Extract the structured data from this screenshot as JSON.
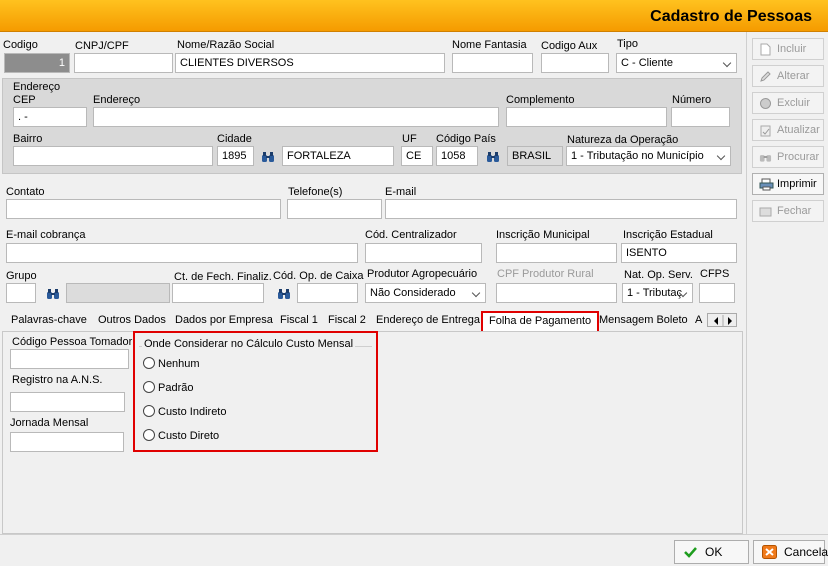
{
  "window": {
    "title": "Cadastro de Pessoas"
  },
  "header": {
    "codigo_label": "Codigo",
    "codigo_value": "1",
    "cnpj_label": "CNPJ/CPF",
    "cnpj_value": "",
    "nome_label": "Nome/Razão Social",
    "nome_value": "CLIENTES DIVERSOS",
    "fantasia_label": "Nome Fantasia",
    "fantasia_value": "",
    "codaux_label": "Codigo Aux",
    "codaux_value": "",
    "tipo_label": "Tipo",
    "tipo_value": "C - Cliente"
  },
  "endereco": {
    "section_label": "Endereço",
    "cep_label": "CEP",
    "cep_value": "  .   -",
    "endereco_label": "Endereço",
    "endereco_value": "",
    "complemento_label": "Complemento",
    "complemento_value": "",
    "numero_label": "Número",
    "numero_value": "",
    "bairro_label": "Bairro",
    "bairro_value": "",
    "cidade_label": "Cidade",
    "cidade_code": "1895",
    "cidade_name": "FORTALEZA",
    "uf_label": "UF",
    "uf_value": "CE",
    "pais_label": "Código País",
    "pais_code": "1058",
    "pais_name": "BRASIL",
    "natureza_label": "Natureza da Operação",
    "natureza_value": "1 - Tributação no Município"
  },
  "contato": {
    "contato_label": "Contato",
    "contato_value": "",
    "telefone_label": "Telefone(s)",
    "telefone_value": "",
    "email_label": "E-mail",
    "email_value": "",
    "email_cobranca_label": "E-mail cobrança",
    "email_cobranca_value": "",
    "centralizador_label": "Cód. Centralizador",
    "centralizador_value": "",
    "insc_mun_label": "Inscrição Municipal",
    "insc_mun_value": "",
    "insc_est_label": "Inscrição Estadual",
    "insc_est_value": "ISENTO"
  },
  "grupo": {
    "grupo_label": "Grupo",
    "grupo_value": "",
    "fech_label": "Ct. de Fech. Finaliz.",
    "fech_value": "",
    "caixa_label": "Cód. Op. de Caixa",
    "caixa_value": "",
    "produtor_label": "Produtor Agropecuário",
    "produtor_value": "Não Considerado",
    "cpf_produtor_label": "CPF Produtor Rural",
    "cpf_produtor_value": "",
    "natop_serv_label": "Nat. Op. Serv.",
    "natop_serv_value": "1 - Tributaç",
    "cfps_label": "CFPS",
    "cfps_value": ""
  },
  "tabs": [
    "Palavras-chave",
    "Outros Dados",
    "Dados por Empresa",
    "Fiscal 1",
    "Fiscal 2",
    "Endereço de Entrega",
    "Folha de Pagamento",
    "Mensagem Boleto",
    "A"
  ],
  "folha": {
    "tomador_label": "Código Pessoa Tomador",
    "tomador_value": "",
    "ans_label": "Registro na A.N.S.",
    "ans_value": "",
    "jornada_label": "Jornada Mensal",
    "jornada_value": "",
    "group_title": "Onde Considerar no Cálculo Custo Mensal",
    "options": [
      "Nenhum",
      "Padrão",
      "Custo Indireto",
      "Custo Direto"
    ]
  },
  "sidebar": {
    "incluir": "Incluir",
    "alterar": "Alterar",
    "excluir": "Excluir",
    "atualizar": "Atualizar",
    "procurar": "Procurar",
    "imprimir": "Imprimir",
    "fechar": "Fechar"
  },
  "footer": {
    "ok": "OK",
    "cancela": "Cancela"
  }
}
